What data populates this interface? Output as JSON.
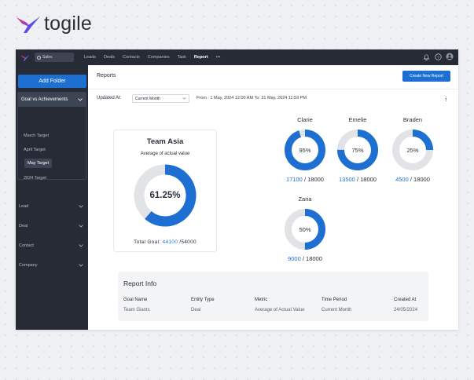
{
  "brand": {
    "name": "togile"
  },
  "topbar": {
    "workspace": "Sales",
    "nav": [
      "Leads",
      "Deals",
      "Contacts",
      "Companies",
      "Task",
      "Report",
      "•••"
    ],
    "active_nav": "Report"
  },
  "sidebar": {
    "add_folder": "Add Folder",
    "group": {
      "label": "Goal vs Achievements",
      "items": [
        "March Target",
        "April Target",
        "May Target",
        "2024 Target"
      ],
      "active": "May Target"
    },
    "sections": [
      "Lead",
      "Deal",
      "Contact",
      "Company"
    ]
  },
  "main": {
    "title": "Reports",
    "create_button": "Create New Report",
    "updated_label": "Updated At:",
    "period_select": "Current Month",
    "range": "From : 1 May, 2024 12:00 AM To: 31 May, 2024 11:59 PM"
  },
  "team": {
    "title": "Team Asia",
    "subtitle": "Average of actual value",
    "percent": "61.25%",
    "percent_value": 61.25,
    "goal_label": "Total Goal:",
    "goal_achieved": "44100",
    "goal_total": "/54000"
  },
  "people": [
    {
      "name": "Clarie",
      "percent": "95%",
      "percent_value": 95,
      "achieved": "17100",
      "target": "/ 18000"
    },
    {
      "name": "Emelie",
      "percent": "75%",
      "percent_value": 75,
      "achieved": "13500",
      "target": "/ 18000"
    },
    {
      "name": "Braden",
      "percent": "25%",
      "percent_value": 25,
      "achieved": "4500",
      "target": "/ 18000"
    },
    {
      "name": "Zaria",
      "percent": "50%",
      "percent_value": 50,
      "achieved": "9000",
      "target": "/ 18000"
    }
  ],
  "report_info": {
    "title": "Report Info",
    "headers": [
      "Goal Name",
      "Entity Type",
      "Metric",
      "Time Period",
      "Created At"
    ],
    "row": [
      "Team Giants",
      "Deal",
      "Average of Actual Value",
      "Current Month",
      "24/05/2024"
    ]
  },
  "colors": {
    "accent": "#1d6fd1",
    "track": "#e2e3e6",
    "dark": "#262b36"
  }
}
